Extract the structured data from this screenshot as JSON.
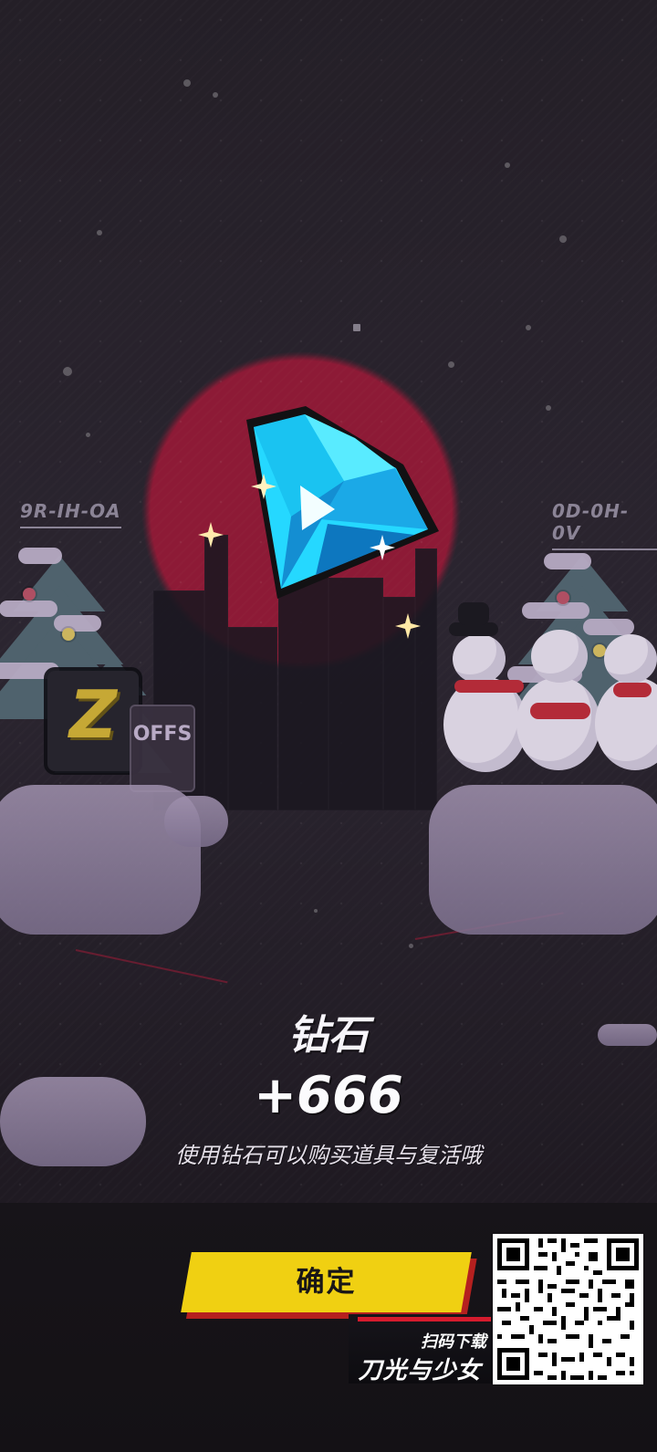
{
  "scene": {
    "left_sign": "9R-IH-OA",
    "right_sign": "0D-0H-0V",
    "z_box_letter": "Z",
    "bag_text": "OFFS"
  },
  "reward": {
    "title": "钻石",
    "amount": "+666",
    "description": "使用钻石可以购买道具与复活哦"
  },
  "actions": {
    "confirm_label": "确定"
  },
  "promo": {
    "small_text": "扫码下载",
    "game_title": "刀光与少女"
  },
  "icons": {
    "diamond": "diamond-icon",
    "sparkle": "sparkle-icon",
    "qr": "qr-code-icon"
  },
  "colors": {
    "button": "#f0d012",
    "button_shadow": "#b5201f",
    "diamond": "#29d8ff",
    "moon": "#911a36"
  }
}
